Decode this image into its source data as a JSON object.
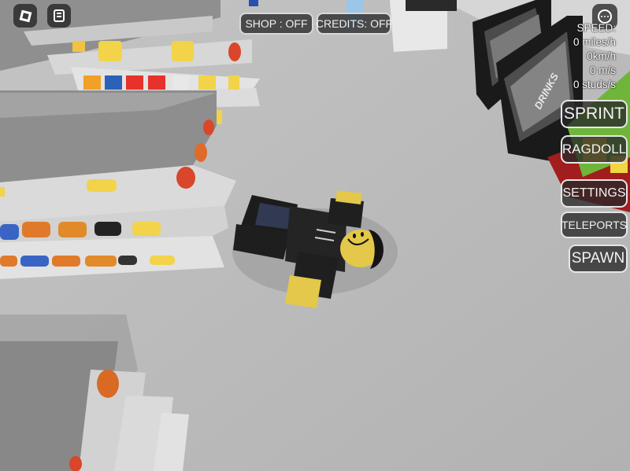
{
  "topbar": {
    "roblox_menu_icon": "roblox-logo-icon",
    "chat_icon": "chat-icon",
    "shop_label": "SHOP : OFF",
    "credits_label": "CREDITS: OFF",
    "more_icon": "more-options-icon"
  },
  "speed_panel": {
    "title": "SPEED:",
    "lines": [
      "0 miles/h",
      "0km/h",
      "0 m/s",
      "0 studs/s"
    ]
  },
  "side_buttons": {
    "sprint": "SPRINT",
    "ragdoll": "RAGDOLL",
    "settings": "SETTINGS",
    "teleports": "TELEPORTS",
    "spawn": "SPAWN"
  },
  "scene": {
    "floor_color": "#b9b9b9",
    "shelf_color": "#8e8e8e",
    "vending_label": "DRINKS"
  }
}
